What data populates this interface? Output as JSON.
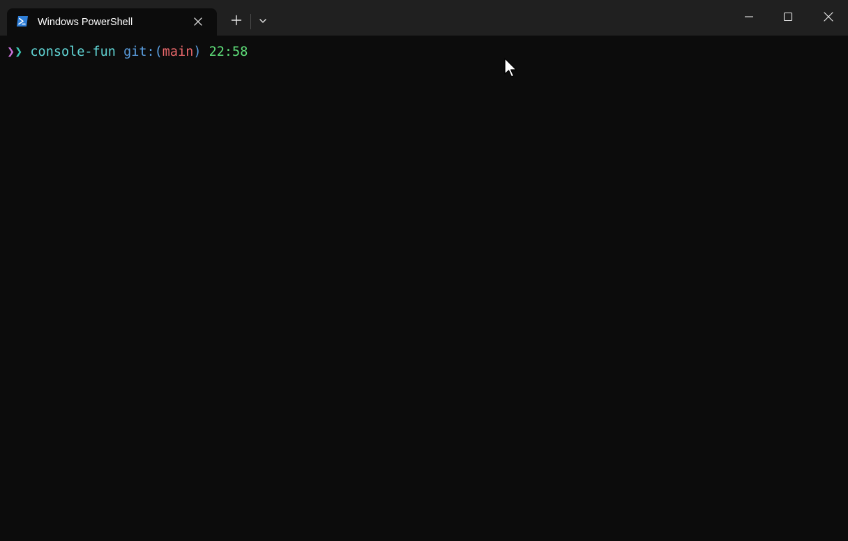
{
  "tab": {
    "title": "Windows PowerShell",
    "icon": "powershell-icon"
  },
  "toolbar": {
    "new_tab_icon": "plus-icon",
    "dropdown_icon": "chevron-down-icon"
  },
  "window_controls": {
    "minimize_icon": "minimize-icon",
    "maximize_icon": "maximize-icon",
    "close_icon": "close-icon"
  },
  "prompt": {
    "symbol_1": "❯",
    "symbol_2": "❯",
    "directory": "console-fun",
    "git_prefix": "git:(",
    "branch": "main",
    "git_suffix": ")",
    "time": "22:58"
  },
  "colors": {
    "background": "#0c0c0c",
    "titlebar": "#202020",
    "chevron_1": "#c770d6",
    "chevron_2": "#3bc5b1",
    "directory": "#61d6d6",
    "git": "#5a9ee0",
    "branch": "#e8676a",
    "time": "#5fe07a"
  }
}
